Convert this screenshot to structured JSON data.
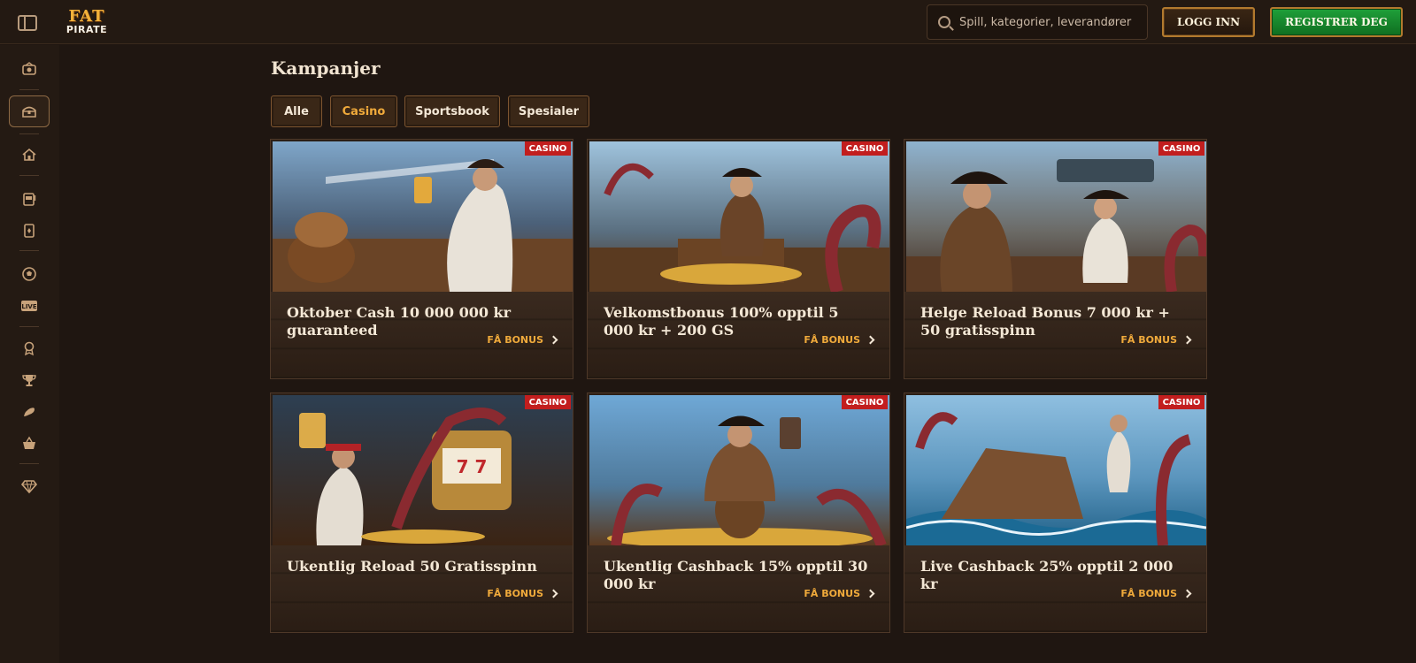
{
  "header": {
    "logo_top": "FAT",
    "logo_bottom": "PIRATE",
    "search_placeholder": "Spill, kategorier, leverandører",
    "login_label": "LOGG INN",
    "register_label": "REGISTRER DEG"
  },
  "sidebar": {
    "items": [
      {
        "icon": "promo-icon"
      },
      {
        "icon": "treasure-chest-icon"
      },
      {
        "icon": "home-icon"
      },
      {
        "icon": "slot-machine-icon"
      },
      {
        "icon": "cards-icon"
      },
      {
        "icon": "soccer-ball-icon"
      },
      {
        "icon": "live-icon",
        "label": "LIVE"
      },
      {
        "icon": "badge-icon"
      },
      {
        "icon": "trophy-icon"
      },
      {
        "icon": "brush-icon"
      },
      {
        "icon": "basket-icon"
      },
      {
        "icon": "diamond-icon"
      }
    ]
  },
  "main": {
    "title": "Kampanjer",
    "filters": [
      {
        "label": "Alle",
        "active": false
      },
      {
        "label": "Casino",
        "active": true
      },
      {
        "label": "Sportsbook",
        "active": false
      },
      {
        "label": "Spesialer",
        "active": false
      }
    ],
    "cards": [
      {
        "badge": "CASINO",
        "title": "Oktober Cash 10 000 000 kr guaranteed",
        "cta": "FÅ BONUS"
      },
      {
        "badge": "CASINO",
        "title": "Velkomstbonus 100% opptil 5 000 kr + 200 GS",
        "cta": "FÅ BONUS"
      },
      {
        "badge": "CASINO",
        "title": "Helge Reload Bonus 7 000 kr + 50 gratisspinn",
        "cta": "FÅ BONUS"
      },
      {
        "badge": "CASINO",
        "title": "Ukentlig Reload 50 Gratisspinn",
        "cta": "FÅ BONUS"
      },
      {
        "badge": "CASINO",
        "title": "Ukentlig Cashback 15% opptil 30 000 kr",
        "cta": "FÅ BONUS"
      },
      {
        "badge": "CASINO",
        "title": "Live Cashback 25% opptil 2 000 kr",
        "cta": "FÅ BONUS"
      }
    ]
  },
  "colors": {
    "background": "#1f1611",
    "accent": "#f0aa3b",
    "badge": "#c21e1e",
    "register_green": "#1fa03a"
  }
}
